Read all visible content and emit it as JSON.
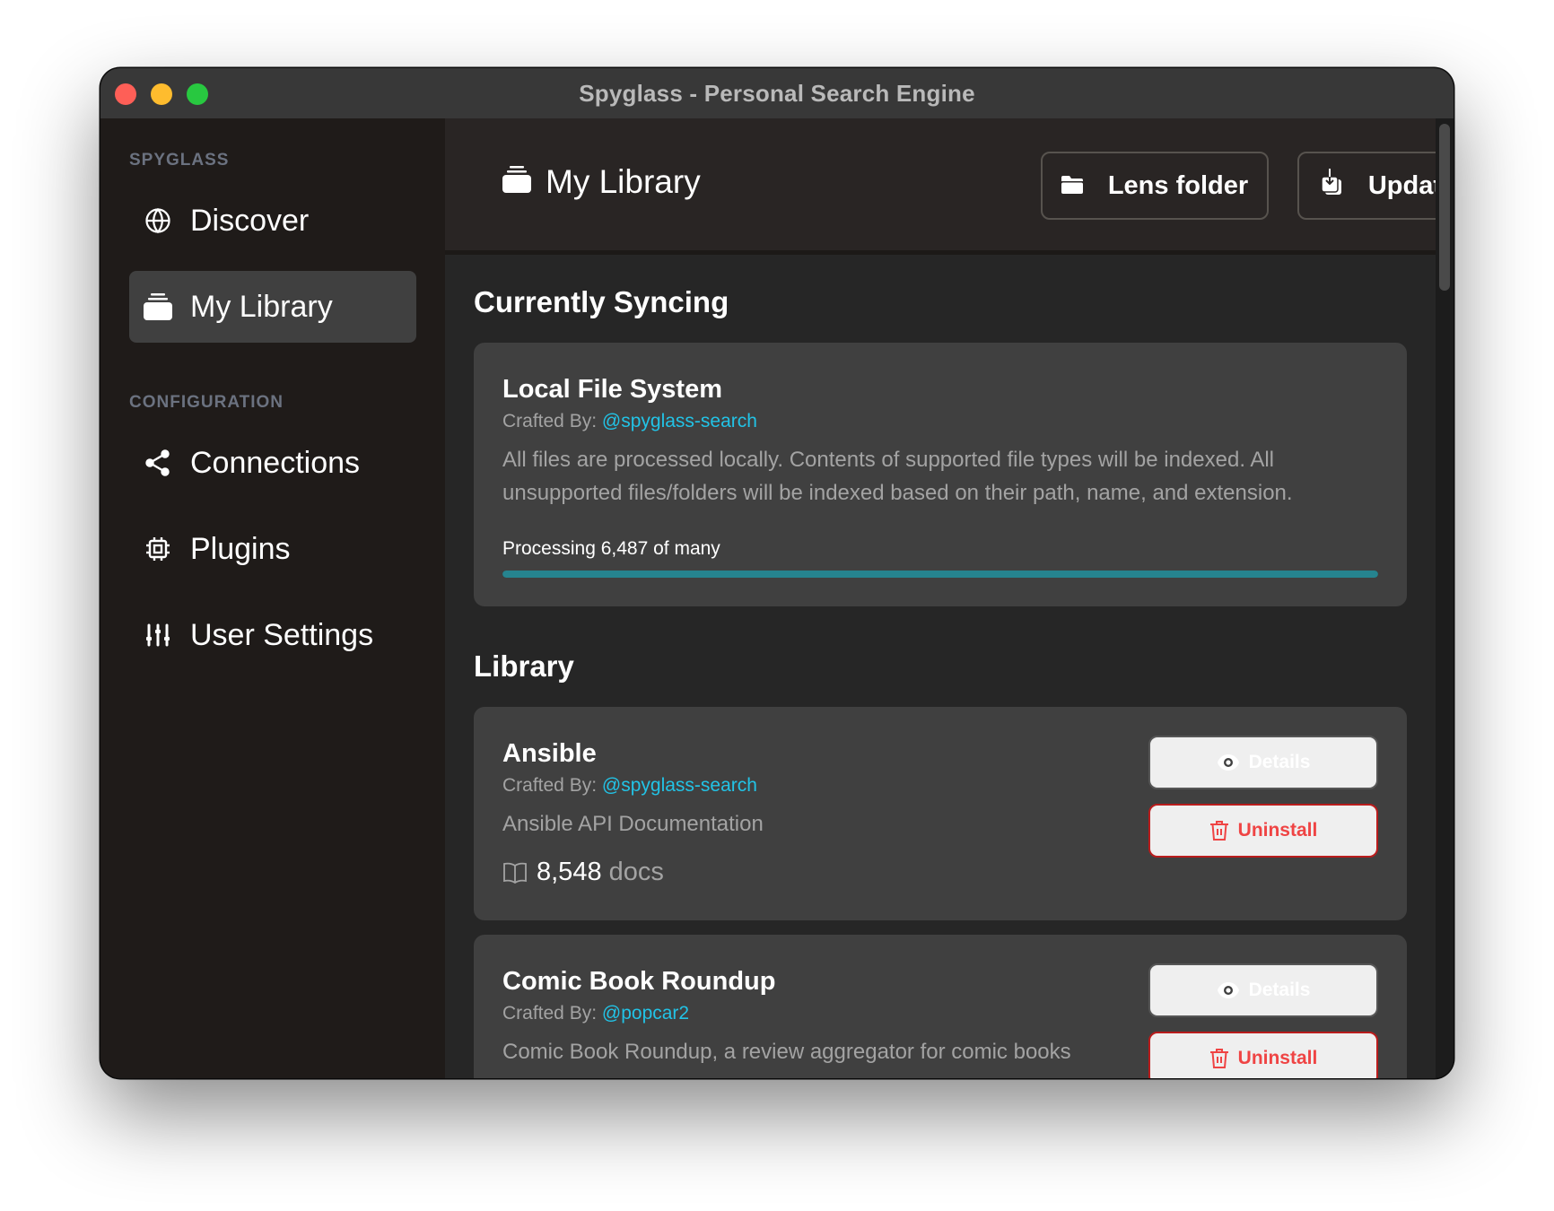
{
  "window": {
    "title": "Spyglass - Personal Search Engine"
  },
  "sidebar": {
    "sections": [
      {
        "heading": "SPYGLASS",
        "items": [
          {
            "label": "Discover",
            "icon": "globe-icon",
            "active": false
          },
          {
            "label": "My Library",
            "icon": "library-icon",
            "active": true
          }
        ]
      },
      {
        "heading": "CONFIGURATION",
        "items": [
          {
            "label": "Connections",
            "icon": "share-icon",
            "active": false
          },
          {
            "label": "Plugins",
            "icon": "chip-icon",
            "active": false
          },
          {
            "label": "User Settings",
            "icon": "sliders-icon",
            "active": false
          }
        ]
      }
    ]
  },
  "header": {
    "title": "My Library",
    "title_icon": "library-icon",
    "lens_folder_label": "Lens folder",
    "update_label": "Update"
  },
  "syncing": {
    "section_title": "Currently Syncing",
    "card": {
      "title": "Local File System",
      "crafted_by_label": "Crafted By:",
      "author": "@spyglass-search",
      "description": "All files are processed locally. Contents of supported file types will be indexed. All unsupported files/folders will be indexed based on their path, name, and extension.",
      "progress_label": "Processing 6,487 of many",
      "progress_percent": 100
    }
  },
  "library": {
    "section_title": "Library",
    "details_label": "Details",
    "uninstall_label": "Uninstall",
    "items": [
      {
        "title": "Ansible",
        "crafted_by_label": "Crafted By:",
        "author": "@spyglass-search",
        "description": "Ansible API Documentation",
        "doc_count": "8,548",
        "doc_unit": "docs"
      },
      {
        "title": "Comic Book Roundup",
        "crafted_by_label": "Crafted By:",
        "author": "@popcar2",
        "description": "Comic Book Roundup, a review aggregator for comic books"
      }
    ]
  },
  "colors": {
    "accent_link": "#22c3e6",
    "progress": "#26848f",
    "danger": "#ef4444"
  }
}
